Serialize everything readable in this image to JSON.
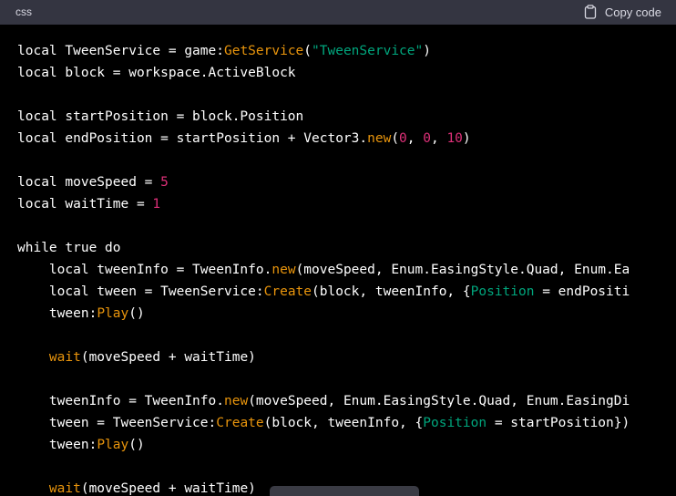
{
  "header": {
    "language": "css",
    "copy_label": "Copy code",
    "copy_icon": "clipboard-icon"
  },
  "colors": {
    "header_bg": "#343541",
    "code_bg": "#000000",
    "text": "#ffffff",
    "method": "#e9950c",
    "string": "#00a67d",
    "number": "#df3079"
  },
  "code": {
    "lines": [
      [
        {
          "t": "local TweenService = game:"
        },
        {
          "t": "GetService",
          "c": "method"
        },
        {
          "t": "("
        },
        {
          "t": "\"TweenService\"",
          "c": "string"
        },
        {
          "t": ")"
        }
      ],
      [
        {
          "t": "local block = workspace.ActiveBlock"
        }
      ],
      [],
      [
        {
          "t": "local startPosition = block.Position"
        }
      ],
      [
        {
          "t": "local endPosition = startPosition + Vector3."
        },
        {
          "t": "new",
          "c": "method"
        },
        {
          "t": "("
        },
        {
          "t": "0",
          "c": "number"
        },
        {
          "t": ", "
        },
        {
          "t": "0",
          "c": "number"
        },
        {
          "t": ", "
        },
        {
          "t": "10",
          "c": "number"
        },
        {
          "t": ")"
        }
      ],
      [],
      [
        {
          "t": "local moveSpeed = "
        },
        {
          "t": "5",
          "c": "number"
        }
      ],
      [
        {
          "t": "local waitTime = "
        },
        {
          "t": "1",
          "c": "number"
        }
      ],
      [],
      [
        {
          "t": "while true do"
        }
      ],
      [
        {
          "t": "    local tweenInfo = TweenInfo."
        },
        {
          "t": "new",
          "c": "method"
        },
        {
          "t": "(moveSpeed, Enum.EasingStyle.Quad, Enum.Ea"
        }
      ],
      [
        {
          "t": "    local tween = TweenService:"
        },
        {
          "t": "Create",
          "c": "method"
        },
        {
          "t": "(block, tweenInfo, {"
        },
        {
          "t": "Position",
          "c": "key"
        },
        {
          "t": " = endPositi"
        }
      ],
      [
        {
          "t": "    tween:"
        },
        {
          "t": "Play",
          "c": "method"
        },
        {
          "t": "()"
        }
      ],
      [],
      [
        {
          "t": "    "
        },
        {
          "t": "wait",
          "c": "method"
        },
        {
          "t": "(moveSpeed + waitTime)"
        }
      ],
      [],
      [
        {
          "t": "    tweenInfo = TweenInfo."
        },
        {
          "t": "new",
          "c": "method"
        },
        {
          "t": "(moveSpeed, Enum.EasingStyle.Quad, Enum.EasingDi"
        }
      ],
      [
        {
          "t": "    tween = TweenService:"
        },
        {
          "t": "Create",
          "c": "method"
        },
        {
          "t": "(block, tweenInfo, {"
        },
        {
          "t": "Position",
          "c": "key"
        },
        {
          "t": " = startPosition})"
        }
      ],
      [
        {
          "t": "    tween:"
        },
        {
          "t": "Play",
          "c": "method"
        },
        {
          "t": "()"
        }
      ],
      [],
      [
        {
          "t": "    "
        },
        {
          "t": "wait",
          "c": "method"
        },
        {
          "t": "(moveSpeed + waitTime)"
        }
      ]
    ]
  }
}
